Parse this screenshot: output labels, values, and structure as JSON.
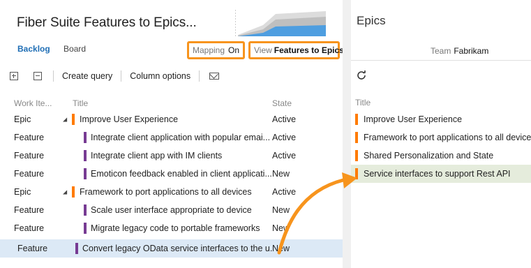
{
  "left": {
    "title": "Fiber Suite Features to Epics...",
    "tabs": [
      {
        "label": "Backlog",
        "active": true
      },
      {
        "label": "Board",
        "active": false
      }
    ],
    "mapping": {
      "label": "Mapping",
      "value": "On"
    },
    "view": {
      "label": "View",
      "value": "Features to Epics"
    },
    "toolbar": {
      "expand_icon": "expand-all-icon",
      "collapse_icon": "collapse-all-icon",
      "create_query": "Create query",
      "column_options": "Column options",
      "email_icon": "mail-icon"
    },
    "columns": {
      "type": "Work Ite...",
      "title": "Title",
      "state": "State"
    },
    "rows": [
      {
        "type": "Epic",
        "title": "Improve User Experience",
        "state": "Active",
        "level": 0,
        "kind": "epic"
      },
      {
        "type": "Feature",
        "title": "Integrate client application with popular emai...",
        "state": "Active",
        "level": 1,
        "kind": "feature"
      },
      {
        "type": "Feature",
        "title": "Integrate client app with IM clients",
        "state": "Active",
        "level": 1,
        "kind": "feature"
      },
      {
        "type": "Feature",
        "title": "Emoticon feedback enabled in client applicati...",
        "state": "New",
        "level": 1,
        "kind": "feature"
      },
      {
        "type": "Epic",
        "title": "Framework to port applications to all devices",
        "state": "Active",
        "level": 0,
        "kind": "epic"
      },
      {
        "type": "Feature",
        "title": "Scale user interface appropriate to device",
        "state": "New",
        "level": 1,
        "kind": "feature"
      },
      {
        "type": "Feature",
        "title": "Migrate legacy code to portable frameworks",
        "state": "New",
        "level": 1,
        "kind": "feature"
      },
      {
        "type": "Feature",
        "title": "Convert legacy OData service interfaces to the u...",
        "state": "New",
        "level": 1,
        "kind": "feature",
        "selected": true
      }
    ]
  },
  "right": {
    "title": "Epics",
    "team_label": "Team",
    "team_value": "Fabrikam",
    "refresh_icon": "refresh-icon",
    "column_title": "Title",
    "items": [
      {
        "title": "Improve User Experience"
      },
      {
        "title": "Framework to port applications to all devices"
      },
      {
        "title": "Shared Personalization and State"
      },
      {
        "title": "Service interfaces to support Rest API",
        "drop_target": true
      }
    ]
  },
  "colors": {
    "accent": "#f7941d",
    "epic": "#ff7b00",
    "feature": "#773b93",
    "link": "#1f6eb5",
    "selected_row": "#dce9f6",
    "drop_row": "#e5ecdc"
  }
}
